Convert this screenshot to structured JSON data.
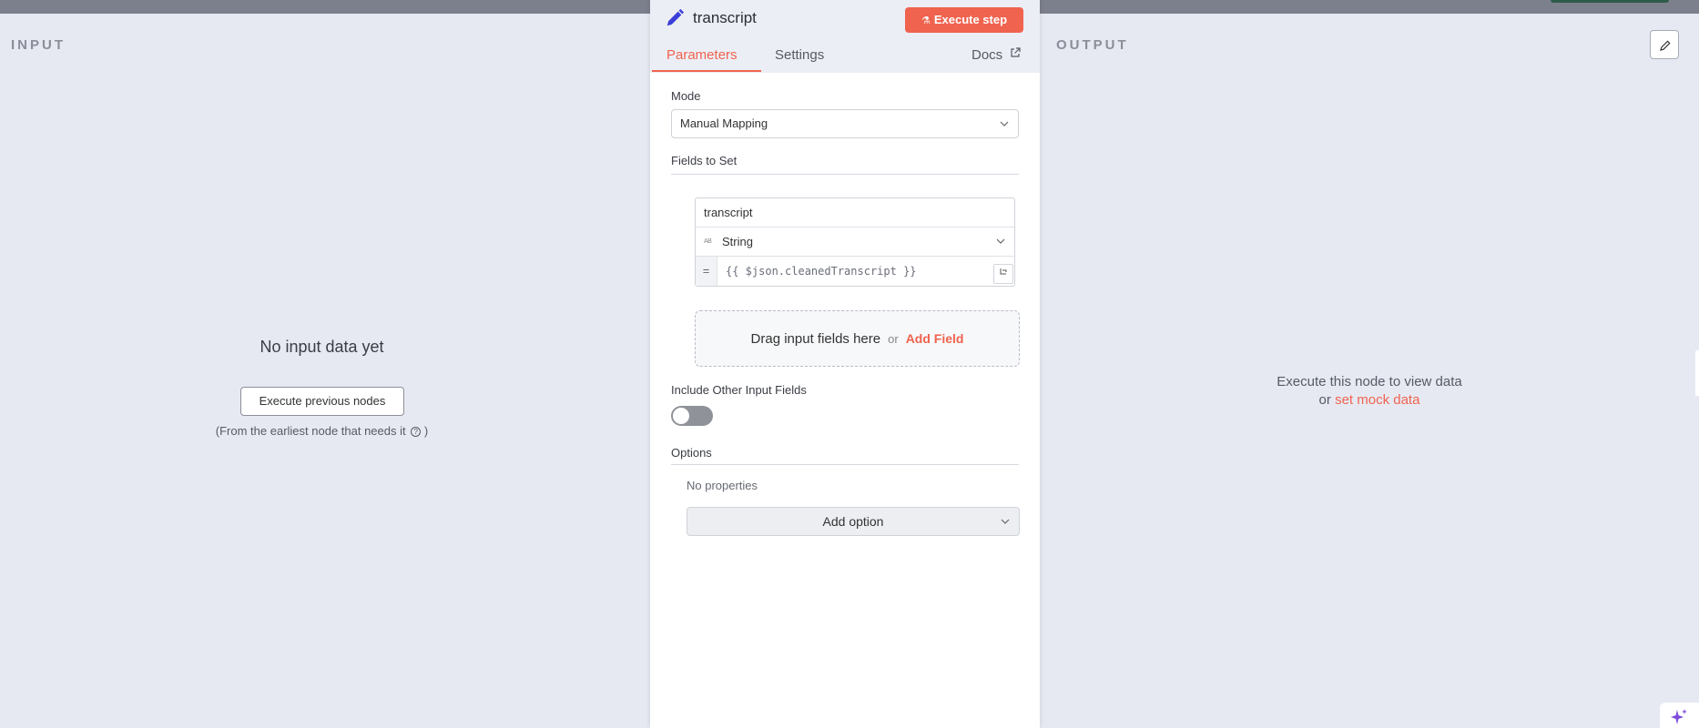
{
  "input_pane": {
    "label": "INPUT",
    "empty_title": "No input data yet",
    "execute_previous_label": "Execute previous nodes",
    "hint_prefix": "(From the earliest node that needs it",
    "hint_icon": "?",
    "hint_suffix": ")"
  },
  "node_panel": {
    "title": "transcript",
    "execute_step_label": "Execute step",
    "tabs": [
      {
        "label": "Parameters",
        "active": true
      },
      {
        "label": "Settings",
        "active": false
      },
      {
        "label": "Docs",
        "active": false
      }
    ],
    "mode": {
      "label": "Mode",
      "value": "Manual Mapping"
    },
    "fields_to_set": {
      "label": "Fields to Set",
      "field": {
        "name": "transcript",
        "type_badge": "AB",
        "type": "String",
        "expression_prefix": "=",
        "expression": "{{ $json.cleanedTranscript }}"
      },
      "drop_zone": {
        "text": "Drag input fields here",
        "or": "or",
        "add_field_label": "Add Field"
      }
    },
    "include_other": {
      "label": "Include Other Input Fields",
      "enabled": false
    },
    "options": {
      "label": "Options",
      "empty_text": "No properties",
      "add_option_label": "Add option"
    }
  },
  "output_pane": {
    "label": "OUTPUT",
    "message_line1": "Execute this node to view data",
    "message_or": "or",
    "mock_link_label": "set mock data"
  },
  "colors": {
    "accent": "#f0634f",
    "background": "#e6e9f2",
    "node_icon": "#3b3fd8"
  },
  "icons": [
    "pencil-icon",
    "flask-icon",
    "external-link-icon",
    "chevron-down-icon",
    "expression-icon",
    "edit-icon",
    "help-icon",
    "sparkle-icon"
  ]
}
